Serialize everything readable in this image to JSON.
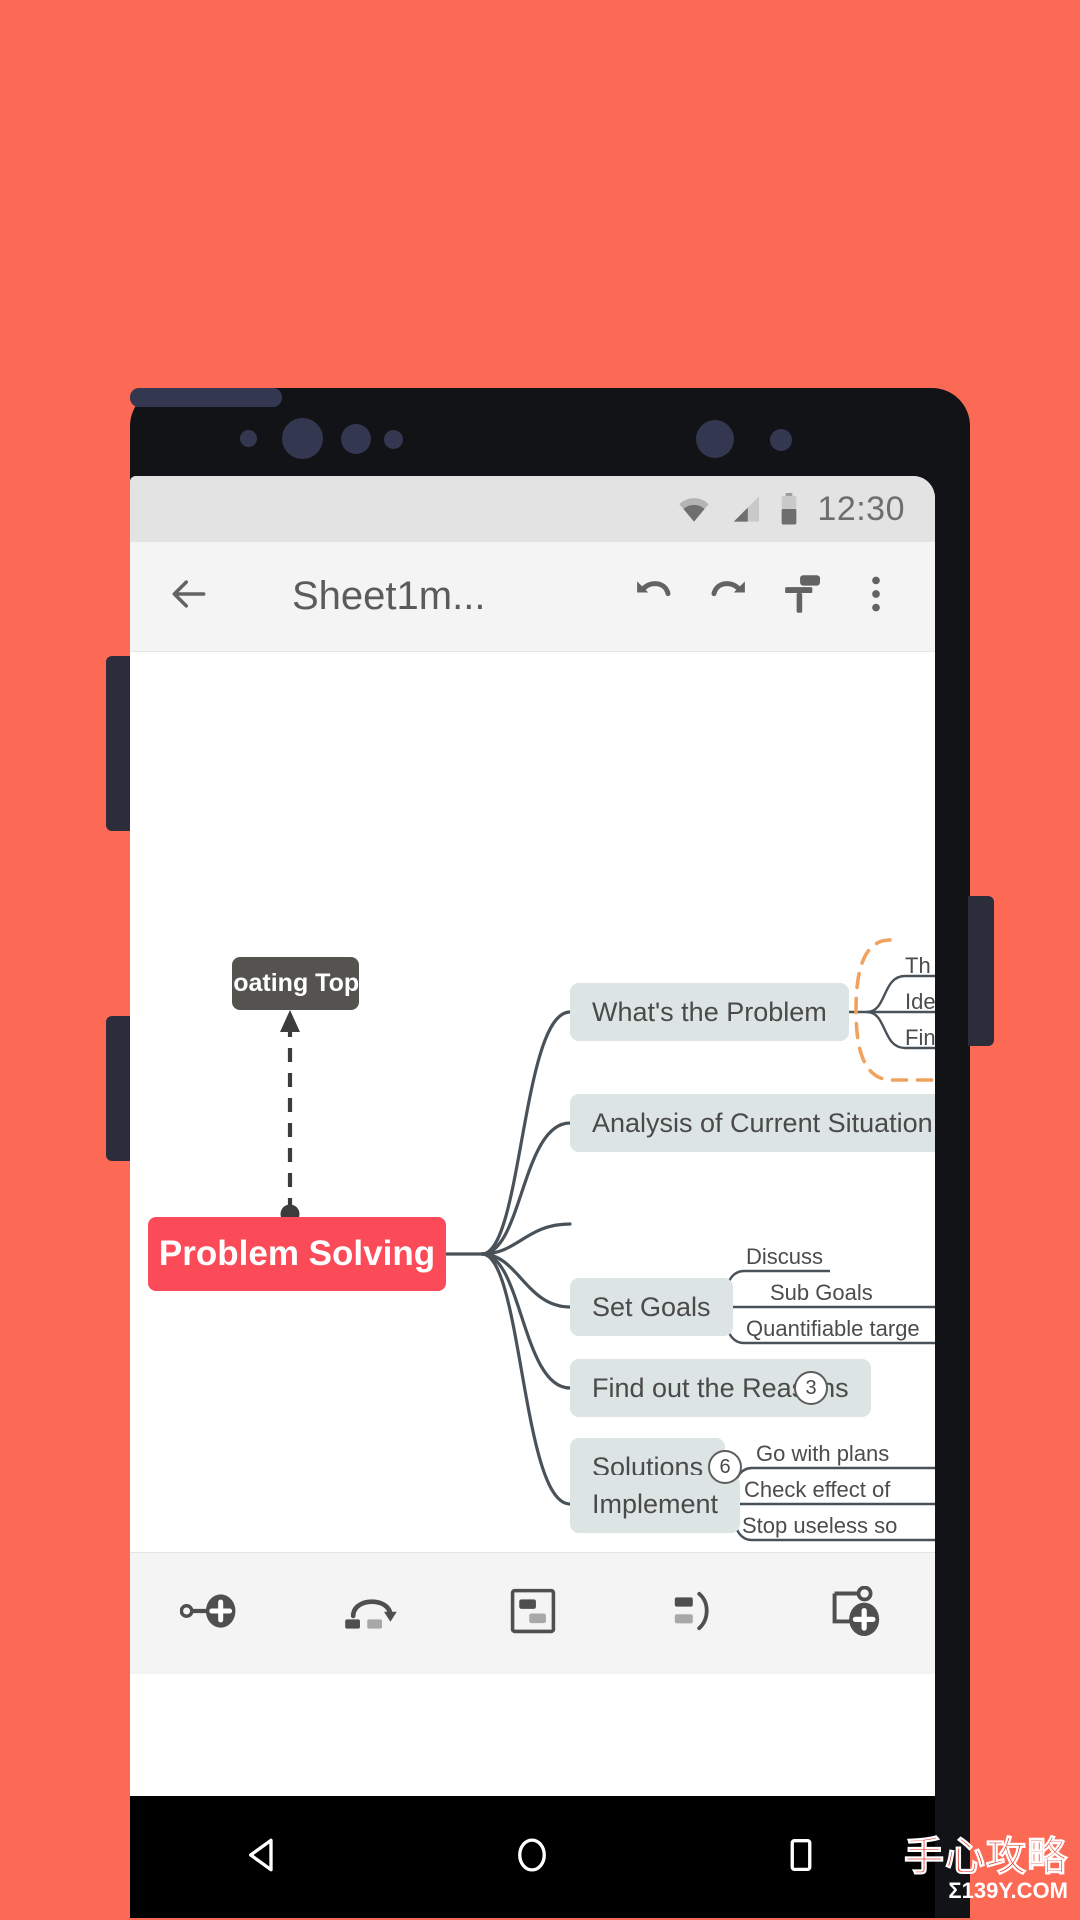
{
  "app": {
    "status_bar": {
      "time": "12:30",
      "icons": [
        "wifi-icon",
        "cellular-signal-icon",
        "battery-icon"
      ]
    },
    "toolbar": {
      "back_label": "",
      "title": "Sheet1m...",
      "undo_label": "",
      "redo_label": "",
      "format_painter_label": "",
      "overflow_label": "",
      "icons": [
        "back-arrow-icon",
        "undo-icon",
        "redo-icon",
        "format-painter-icon",
        "overflow-menu-icon"
      ]
    },
    "bottom_toolbar": {
      "items": [
        {
          "name": "add-subtopic-button",
          "icon": "add-subtopic-icon",
          "label": ""
        },
        {
          "name": "add-relationship-button",
          "icon": "relationship-arrow-icon",
          "label": ""
        },
        {
          "name": "add-boundary-button",
          "icon": "boundary-box-icon",
          "label": ""
        },
        {
          "name": "add-summary-button",
          "icon": "summary-bracket-icon",
          "label": ""
        },
        {
          "name": "add-floating-topic-button",
          "icon": "add-floating-topic-icon",
          "label": ""
        }
      ]
    },
    "nav_bar": {
      "back_label": "",
      "home_label": "",
      "recents_label": "",
      "icons": [
        "nav-back-triangle-icon",
        "nav-home-circle-icon",
        "nav-recents-square-icon"
      ]
    }
  },
  "mindmap": {
    "root": {
      "text": "Problem Solving",
      "color": "#FB4B58",
      "text_color": "#ffffff"
    },
    "floating_topic": {
      "text": "Floating Topic",
      "color": "#54534F",
      "text_color": "#ffffff"
    },
    "branch_color": "#DDE4E4",
    "boundary_color": "#F0A35E",
    "branches": [
      {
        "text": "What's the Problem",
        "collapsed_count": null,
        "children": [
          "Th",
          "Ide",
          "Fin"
        ],
        "has_boundary": true
      },
      {
        "text": "Analysis of Current Situation",
        "collapsed_count": null,
        "children": [],
        "has_boundary": false
      },
      {
        "text": "Set Goals",
        "collapsed_count": null,
        "children": [
          "Discuss",
          "Sub Goals",
          "Quantifiable targe"
        ],
        "has_boundary": false
      },
      {
        "text": "Find out the Reasons",
        "collapsed_count": "3",
        "children": [],
        "has_boundary": false
      },
      {
        "text": "Solutions",
        "collapsed_count": "6",
        "children": [],
        "has_boundary": false
      },
      {
        "text": "Implement",
        "collapsed_count": null,
        "children": [
          "Go with plans",
          "Check effect of",
          "Stop useless so"
        ],
        "has_boundary": false
      }
    ]
  },
  "watermark": {
    "primary": "手心攻略",
    "secondary": "Σ139Y.COM"
  }
}
